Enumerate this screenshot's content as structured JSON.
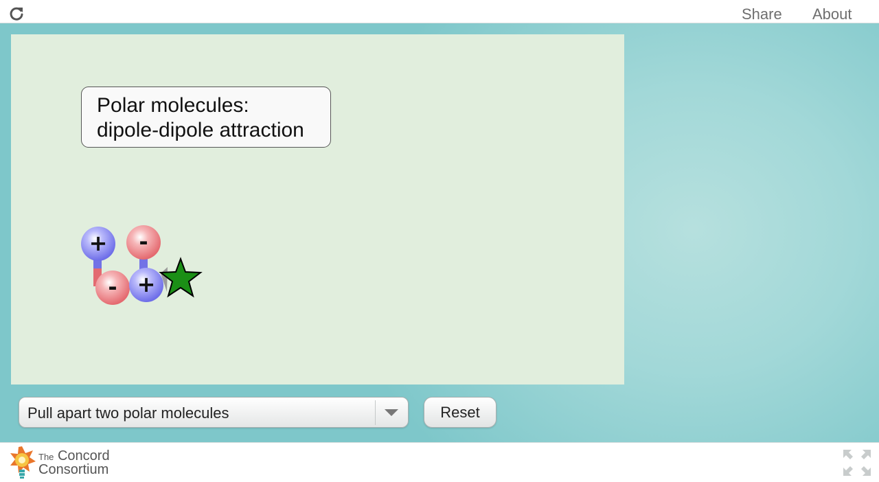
{
  "topbar": {
    "share_label": "Share",
    "about_label": "About"
  },
  "simulation": {
    "title_line1": "Polar molecules:",
    "title_line2": "dipole-dipole attraction",
    "atom_charges": [
      "+",
      "-",
      "-",
      "+"
    ],
    "colors": {
      "positive_atom": "#7f7ff0",
      "negative_atom": "#ee8488",
      "star": "#1b8f16",
      "canvas_background": "#e1eedd"
    }
  },
  "controls": {
    "select": {
      "selected": "Pull apart two polar molecules"
    },
    "reset_label": "Reset"
  },
  "footer": {
    "logo_line1_small": "The",
    "logo_line1": "Concord",
    "logo_line2": "Consortium"
  },
  "icons": {
    "reload": "reload-icon",
    "select_arrow": "chevron-down-icon",
    "fullscreen": "fullscreen-icon",
    "logo": "concord-logo"
  }
}
